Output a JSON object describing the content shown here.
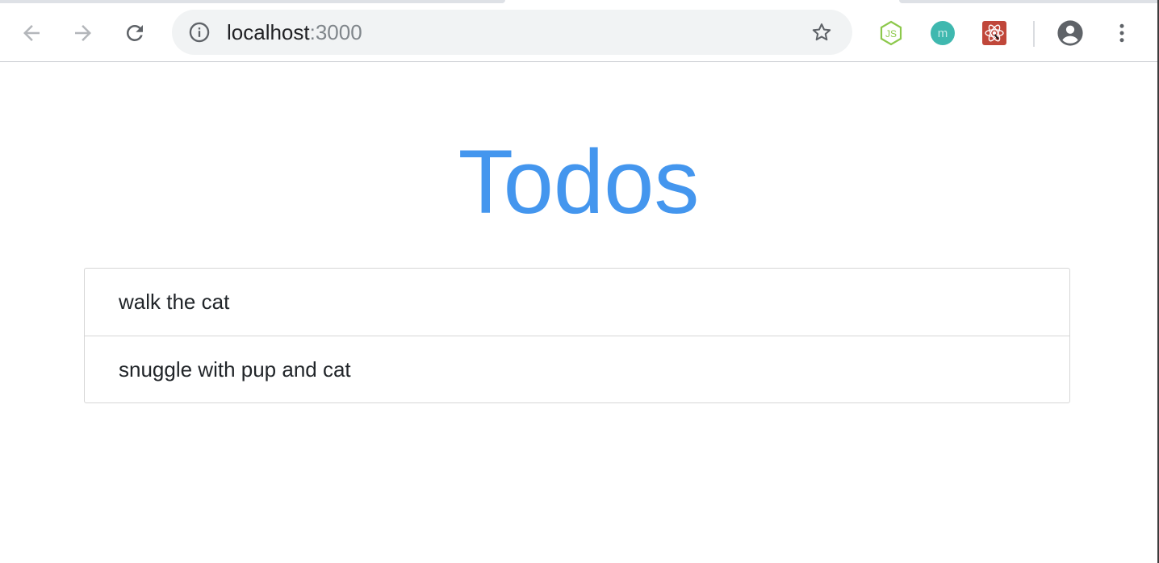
{
  "browser": {
    "url": {
      "host": "localhost",
      "port": ":3000"
    },
    "toolbar": {
      "back": "arrow-left-icon",
      "forward": "arrow-right-icon",
      "reload": "reload-icon",
      "site_info": "info-icon",
      "bookmark": "star-icon",
      "extensions": [
        {
          "name": "nodejs-extension-icon",
          "color": "#8cc84b",
          "label": "JS"
        },
        {
          "name": "m-extension-icon",
          "color": "#3fb8af",
          "label": "m"
        },
        {
          "name": "react-extension-icon",
          "color": "#c0473a",
          "label": ""
        }
      ],
      "profile": "account-icon",
      "menu": "more-vert-icon"
    }
  },
  "app": {
    "title": "Todos",
    "title_color": "#4496ee",
    "todos": [
      {
        "text": "walk the cat"
      },
      {
        "text": "snuggle with pup and cat"
      }
    ]
  }
}
